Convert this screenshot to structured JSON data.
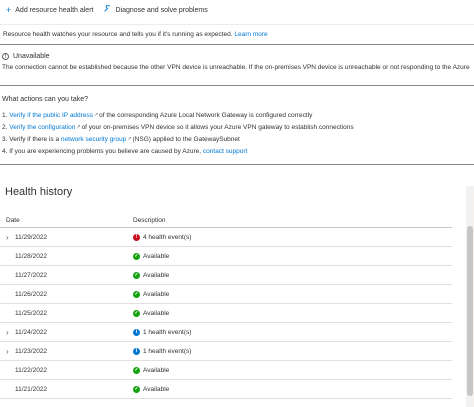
{
  "toolbar": {
    "add_alert": "Add resource health alert",
    "diagnose": "Diagnose and solve problems"
  },
  "info": {
    "text": "Resource health watches your resource and tells you if it's running as expected.",
    "link": "Learn more"
  },
  "status": {
    "label": "Unavailable",
    "description": "The connection cannot be established because the other VPN device is unreachable. If the on-premises VPN device is unreachable or not responding to the Azure"
  },
  "actions": {
    "title": "What actions can you take?",
    "items": [
      {
        "num": "1.",
        "link": "Verify if the public IP address",
        "text": "of the corresponding Azure Local Network Gateway is configured correctly"
      },
      {
        "num": "2.",
        "link": "Verify the configuration",
        "text": "of your on-premises VPN device so it allows your Azure VPN gateway to establish connections"
      },
      {
        "num": "3.",
        "pre": "Verify if there is a",
        "link": "network security group",
        "text": "(NSG) applied to the GatewaySubnet"
      },
      {
        "num": "4.",
        "pre": "If you are experiencing problems you believe are caused by Azure,",
        "link": "contact support"
      }
    ]
  },
  "health_history": {
    "title": "Health history",
    "columns": {
      "date": "Date",
      "description": "Description"
    },
    "rows": [
      {
        "date": "11/29/2022",
        "desc": "4 health event(s)",
        "kind": "error",
        "expandable": true
      },
      {
        "date": "11/28/2022",
        "desc": "Available",
        "kind": "ok",
        "expandable": false
      },
      {
        "date": "11/27/2022",
        "desc": "Available",
        "kind": "ok",
        "expandable": false
      },
      {
        "date": "11/26/2022",
        "desc": "Available",
        "kind": "ok",
        "expandable": false
      },
      {
        "date": "11/25/2022",
        "desc": "Available",
        "kind": "ok",
        "expandable": false
      },
      {
        "date": "11/24/2022",
        "desc": "1 health event(s)",
        "kind": "info",
        "expandable": true
      },
      {
        "date": "11/23/2022",
        "desc": "1 health event(s)",
        "kind": "info",
        "expandable": true
      },
      {
        "date": "11/22/2022",
        "desc": "Available",
        "kind": "ok",
        "expandable": false
      },
      {
        "date": "11/21/2022",
        "desc": "Available",
        "kind": "ok",
        "expandable": false
      }
    ]
  },
  "colors": {
    "link": "#0078d4",
    "error": "#c50f1f",
    "ok": "#13a10e",
    "info": "#0078d4"
  }
}
